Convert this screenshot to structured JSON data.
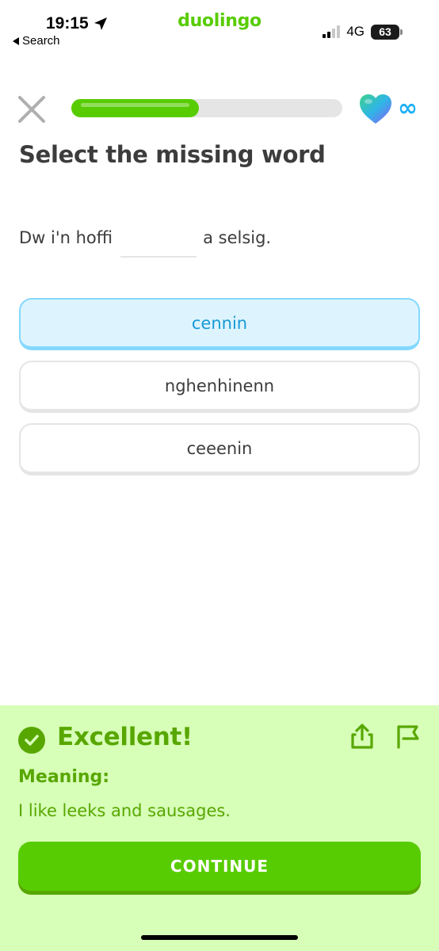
{
  "status_bar": {
    "time": "19:15",
    "back_label": "Search",
    "app_name": "duolingo",
    "network": "4G",
    "battery": "63"
  },
  "lesson": {
    "progress": 0.47,
    "lives": "∞"
  },
  "exercise": {
    "prompt": "Select the missing word",
    "sentence_before": "Dw i'n hoffi",
    "sentence_after": "a selsig.",
    "options": [
      {
        "label": "cennin",
        "selected": true
      },
      {
        "label": "nghenhinenn",
        "selected": false
      },
      {
        "label": "ceeenin",
        "selected": false
      }
    ]
  },
  "feedback": {
    "title": "Excellent!",
    "meaning_label": "Meaning:",
    "meaning_text": "I like leeks and sausages.",
    "continue_label": "CONTINUE"
  },
  "colors": {
    "brand_green": "#58cc02",
    "feedback_bg": "#d7ffb8",
    "feedback_text": "#58a700",
    "selected_bg": "#ddf4ff",
    "selected_border": "#84d8ff",
    "selected_text": "#1899d6"
  },
  "icons": [
    "location-arrow-icon",
    "back-caret-icon",
    "signal-icon",
    "battery-icon",
    "close-icon",
    "heart-icon",
    "infinity-icon",
    "checkmark-icon",
    "share-icon",
    "flag-icon"
  ]
}
